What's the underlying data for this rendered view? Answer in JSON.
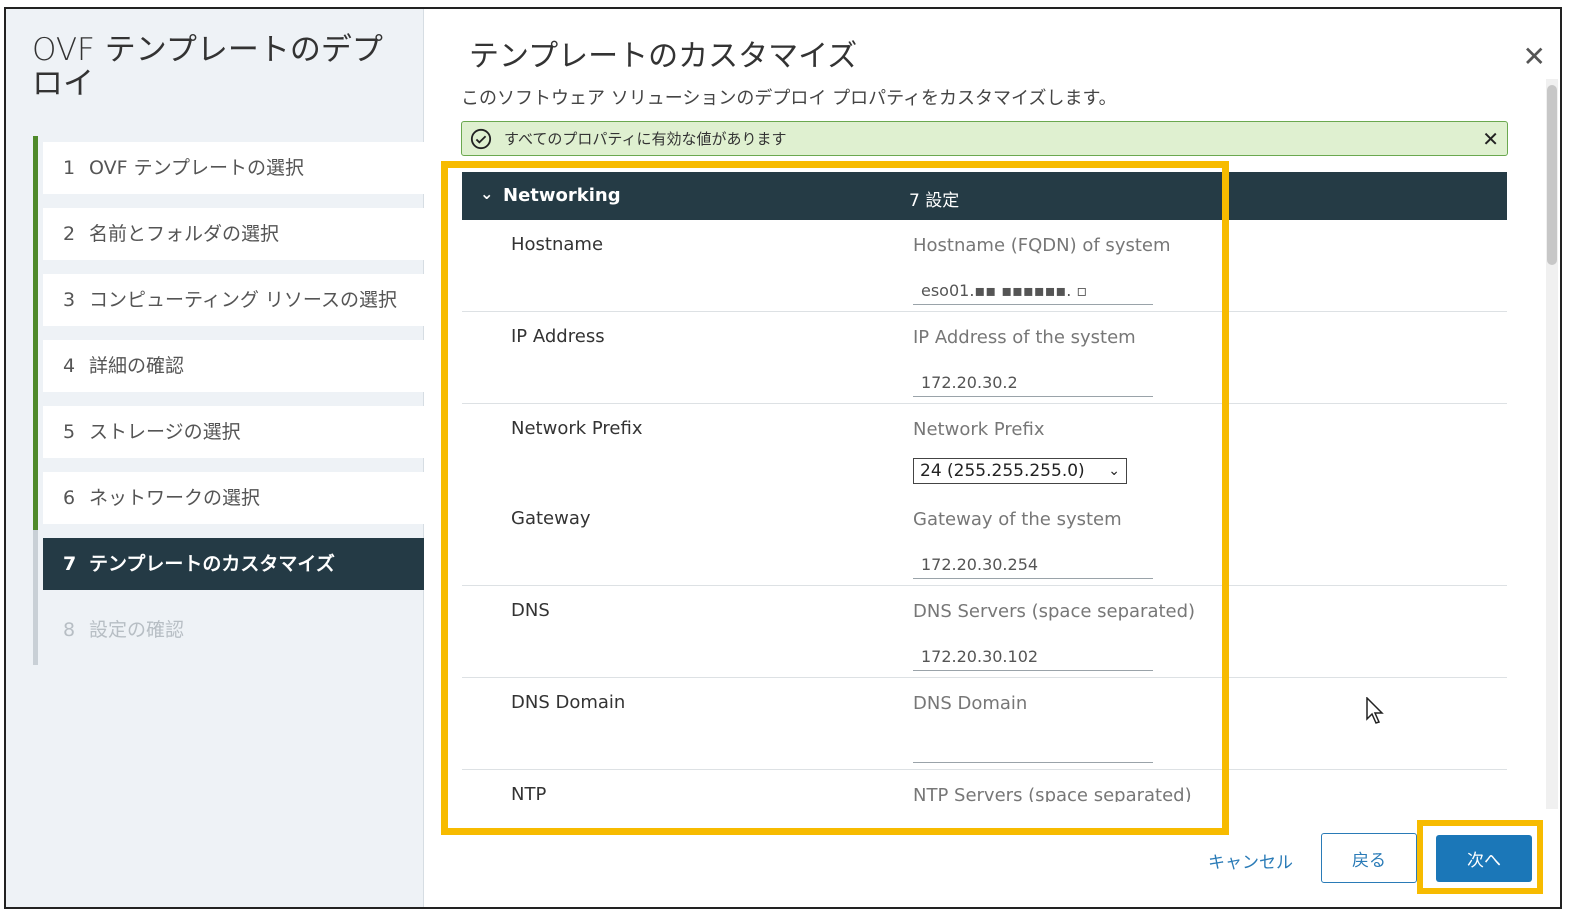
{
  "wizard": {
    "title": "OVF テンプレートのデプロイ",
    "steps": [
      {
        "num": "1",
        "label": "OVF テンプレートの選択"
      },
      {
        "num": "2",
        "label": "名前とフォルダの選択"
      },
      {
        "num": "3",
        "label": "コンピューティング リソースの選択"
      },
      {
        "num": "4",
        "label": "詳細の確認"
      },
      {
        "num": "5",
        "label": "ストレージの選択"
      },
      {
        "num": "6",
        "label": "ネットワークの選択"
      },
      {
        "num": "7",
        "label": "テンプレートのカスタマイズ"
      },
      {
        "num": "8",
        "label": "設定の確認"
      }
    ]
  },
  "main": {
    "title": "テンプレートのカスタマイズ",
    "subtitle": "このソフトウェア ソリューションのデプロイ プロパティをカスタマイズします。",
    "alert": "すべてのプロパティに有効な値があります",
    "section": {
      "name": "Networking",
      "count": "7 設定"
    },
    "rows": [
      {
        "label": "Hostname",
        "desc": "Hostname (FQDN) of system",
        "value": "eso01.▪▪ ▪▪▪▪▪▪. ▫"
      },
      {
        "label": "IP Address",
        "desc": "IP Address of the system",
        "value": "172.20.30.2"
      },
      {
        "label": "Network Prefix",
        "desc": "Network Prefix",
        "value": "24 (255.255.255.0)"
      },
      {
        "label": "Gateway",
        "desc": "Gateway of the system",
        "value": "172.20.30.254"
      },
      {
        "label": "DNS",
        "desc": "DNS Servers (space separated)",
        "value": "172.20.30.102"
      },
      {
        "label": "DNS Domain",
        "desc": "DNS Domain",
        "value": ""
      },
      {
        "label": "NTP",
        "desc": "NTP Servers (space separated)",
        "value": ""
      }
    ]
  },
  "footer": {
    "cancel": "キャンセル",
    "back": "戻る",
    "next": "次へ"
  },
  "colors": {
    "accent": "#1b77b8",
    "highlight": "#f7bb00",
    "section_bg": "#253b45",
    "done_bar": "#4f8a2a"
  }
}
